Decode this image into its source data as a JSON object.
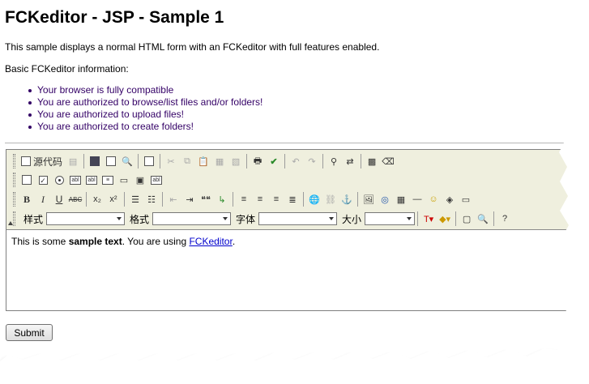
{
  "page": {
    "title": "FCKeditor - JSP - Sample 1",
    "intro": "This sample displays a normal HTML form with an FCKeditor with full features enabled.",
    "info_heading": "Basic FCKeditor information:",
    "info_items": [
      "Your browser is fully compatible",
      "You are authorized to browse/list files and/or folders!",
      "You are authorized to upload files!",
      "You are authorized to create folders!"
    ]
  },
  "toolbar": {
    "source_label": "源代码",
    "style_label": "样式",
    "format_label": "格式",
    "font_label": "字体",
    "size_label": "大小",
    "style_value": "",
    "format_value": "",
    "font_value": "",
    "size_value": "",
    "bold": "B",
    "italic": "I",
    "underline": "U",
    "strike": "ABC",
    "subscript": "x₂",
    "superscript": "x²",
    "blockquote": "❝❝"
  },
  "editor": {
    "text_before": "This is some ",
    "text_bold": "sample text",
    "text_middle": ". You are using ",
    "link_text": "FCKeditor",
    "text_after": "."
  },
  "form": {
    "submit_label": "Submit"
  },
  "colors": {
    "toolbar_bg": "#efefde",
    "bullet_text": "#330066",
    "link": "#0000cc"
  }
}
